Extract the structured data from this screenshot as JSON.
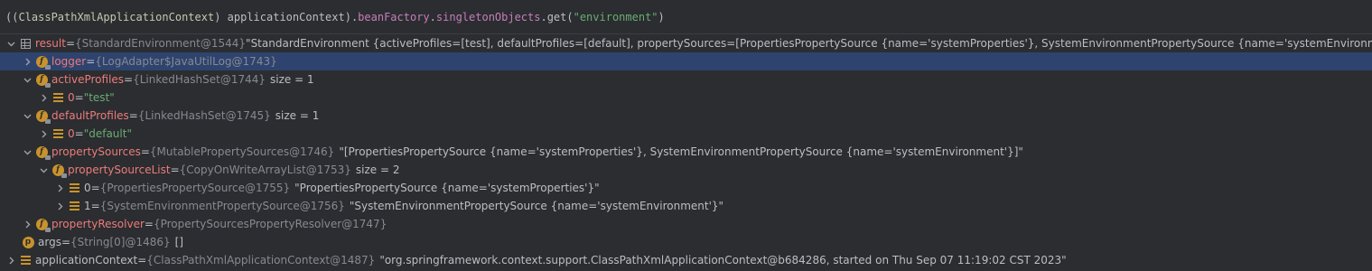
{
  "expression": {
    "open": "((",
    "cast_class": "ClassPathXmlApplicationContext",
    "close_cast": ")",
    "var": " applicationContext",
    "close": ").",
    "field": "beanFactory",
    "dot": ".",
    "field2": "singletonObjects",
    "method": ".get(",
    "arg": "\"environment\"",
    "end": ")"
  },
  "tree": {
    "result": {
      "name": "result",
      "eq": " = ",
      "type": "{StandardEnvironment@1544}",
      "value": "\"StandardEnvironment {activeProfiles=[test], defaultProfiles=[default], propertySources=[PropertiesPropertySource {name='systemProperties'}, SystemEnvironmentPropertySource {name='systemEnvironment'}]}\""
    },
    "logger": {
      "name": "logger",
      "eq": " = ",
      "type": "{LogAdapter$JavaUtilLog@1743}"
    },
    "activeProfiles": {
      "name": "activeProfiles",
      "eq": " = ",
      "type": "{LinkedHashSet@1744}",
      "size": "size = 1"
    },
    "activeProfiles_0": {
      "name": "0",
      "eq": " = ",
      "value": "\"test\""
    },
    "defaultProfiles": {
      "name": "defaultProfiles",
      "eq": " = ",
      "type": "{LinkedHashSet@1745}",
      "size": "size = 1"
    },
    "defaultProfiles_0": {
      "name": "0",
      "eq": " = ",
      "value": "\"default\""
    },
    "propertySources": {
      "name": "propertySources",
      "eq": " = ",
      "type": "{MutablePropertySources@1746}",
      "value": "\"[PropertiesPropertySource {name='systemProperties'}, SystemEnvironmentPropertySource {name='systemEnvironment'}]\""
    },
    "propertySourceList": {
      "name": "propertySourceList",
      "eq": " = ",
      "type": "{CopyOnWriteArrayList@1753}",
      "size": "size = 2"
    },
    "psl_0": {
      "name": "0",
      "eq": " = ",
      "type": "{PropertiesPropertySource@1755}",
      "value": "\"PropertiesPropertySource {name='systemProperties'}\""
    },
    "psl_1": {
      "name": "1",
      "eq": " = ",
      "type": "{SystemEnvironmentPropertySource@1756}",
      "value": "\"SystemEnvironmentPropertySource {name='systemEnvironment'}\""
    },
    "propertyResolver": {
      "name": "propertyResolver",
      "eq": " = ",
      "type": "{PropertySourcesPropertyResolver@1747}"
    },
    "args": {
      "name": "args",
      "eq": " = ",
      "type": "{String[0]@1486}",
      "value": "[]"
    },
    "applicationContext": {
      "name": "applicationContext",
      "eq": " = ",
      "type": "{ClassPathXmlApplicationContext@1487}",
      "value": "\"org.springframework.context.support.ClassPathXmlApplicationContext@b684286, started on Thu Sep 07 11:19:02 CST 2023\""
    }
  },
  "colors": {
    "background": "#2b2d30",
    "selection": "#2e436e",
    "field_name": "#ec7b7b",
    "type_text": "#868a91",
    "string": "#6aab73",
    "icon_orange": "#c9932b"
  },
  "icons": {
    "expand_collapsed": "chevron-right-icon",
    "expand_open": "chevron-down-icon",
    "field": "field-icon",
    "parameter": "parameter-icon",
    "array_element": "element-icon",
    "result": "table-icon"
  }
}
